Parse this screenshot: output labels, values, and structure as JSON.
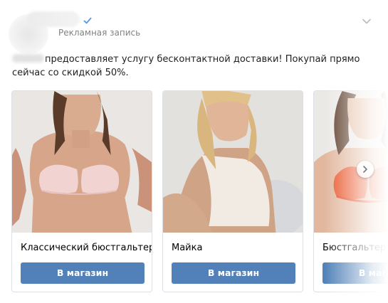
{
  "post": {
    "author_name": "",
    "ad_label": "Рекламная запись",
    "text_brand": "",
    "text_body": "предоставляет услугу бесконтактной доставки! Покупай прямо сейчас со скидкой 50%."
  },
  "icons": {
    "verified": "verified-check-icon",
    "menu": "chevron-down-icon",
    "carousel_next": "chevron-right-icon"
  },
  "colors": {
    "accent": "#5181b8",
    "verified": "#5c9ce6",
    "muted_text": "#828282"
  },
  "carousel": {
    "cards": [
      {
        "title": "Классический бюстгальтер",
        "button": "В магазин"
      },
      {
        "title": "Майка",
        "button": "В магазин"
      },
      {
        "title": "Бюстгальтер с",
        "button": "В магазин"
      }
    ]
  }
}
